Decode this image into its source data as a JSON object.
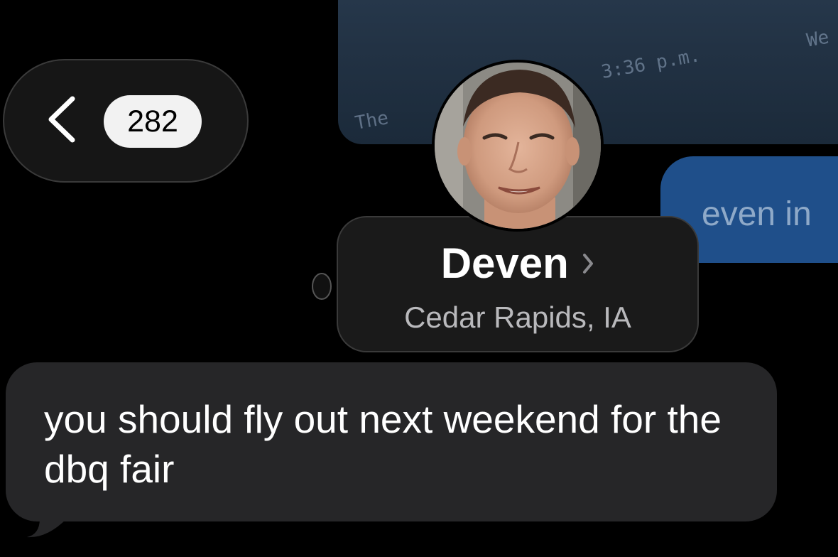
{
  "thread_preview": {
    "image_bubble": {
      "texts": [
        "3:36 p.m.",
        "We",
        "The"
      ]
    },
    "outgoing_preview_text": "even in"
  },
  "header": {
    "back_button": {
      "icon": "chevron-left-icon",
      "unread_count": "282"
    },
    "contact": {
      "name": "Deven",
      "location": "Cedar Rapids, IA",
      "chevron_icon": "chevron-right-icon"
    }
  },
  "messages": [
    {
      "direction": "incoming",
      "text": "you should fly out next weekend for the dbq fair"
    }
  ],
  "colors": {
    "background": "#000000",
    "incoming_bubble": "#262628",
    "outgoing_bubble": "#1f4f8a",
    "badge": "#f2f2f2"
  }
}
